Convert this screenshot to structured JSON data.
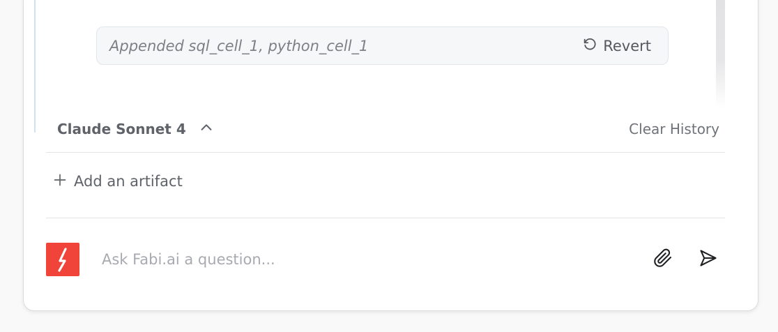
{
  "history": {
    "status_text": "Appended sql_cell_1, python_cell_1",
    "revert_label": "Revert"
  },
  "model_selector": {
    "label": "Claude Sonnet 4",
    "icon": "chevron-up-icon"
  },
  "clear_history_label": "Clear History",
  "artifact": {
    "add_label": "Add an artifact",
    "icon": "plus-icon"
  },
  "chat_input": {
    "placeholder": "Ask Fabi.ai a question...",
    "value": ""
  },
  "icons": {
    "logo": "fabi-logo-icon",
    "attach": "paperclip-icon",
    "send": "send-icon",
    "revert": "undo-icon"
  },
  "colors": {
    "brand": "#f0443a",
    "thread_line": "#cfe3f0"
  }
}
